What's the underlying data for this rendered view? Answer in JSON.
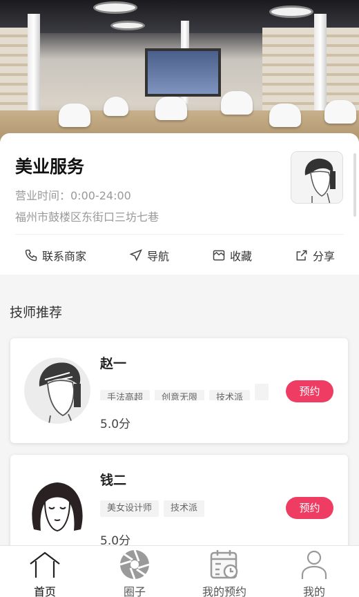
{
  "store": {
    "title": "美业服务",
    "hours": "营业时间：0:00-24:00",
    "address": "福州市鼓楼区东街口三坊七巷"
  },
  "actions": [
    {
      "label": "联系商家",
      "icon": "phone-icon"
    },
    {
      "label": "导航",
      "icon": "navigation-icon"
    },
    {
      "label": "收藏",
      "icon": "favorite-icon"
    },
    {
      "label": "分享",
      "icon": "share-icon"
    }
  ],
  "section": {
    "title": "技师推荐"
  },
  "technicians": [
    {
      "name": "赵一",
      "tags": [
        "手法高超",
        "创意无限",
        "技术派",
        ""
      ],
      "rating": "5.0分",
      "button": "预约"
    },
    {
      "name": "钱二",
      "tags": [
        "美女设计师",
        "技术派"
      ],
      "rating": "5.0分",
      "button": "预约"
    }
  ],
  "tabbar": [
    {
      "label": "首页",
      "icon": "home-icon",
      "active": true
    },
    {
      "label": "圈子",
      "icon": "aperture-icon"
    },
    {
      "label": "我的预约",
      "icon": "calendar-icon"
    },
    {
      "label": "我的",
      "icon": "user-icon"
    }
  ],
  "colors": {
    "accent": "#ef3c63",
    "muted_text": "#999999",
    "background": "#f5f5f5"
  }
}
